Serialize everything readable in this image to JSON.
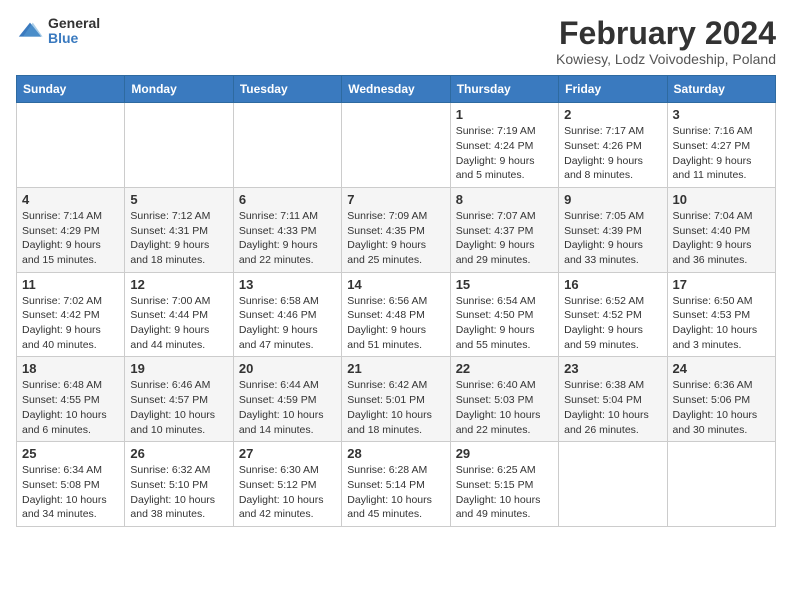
{
  "logo": {
    "line1": "General",
    "line2": "Blue"
  },
  "title": "February 2024",
  "location": "Kowiesy, Lodz Voivodeship, Poland",
  "days_of_week": [
    "Sunday",
    "Monday",
    "Tuesday",
    "Wednesday",
    "Thursday",
    "Friday",
    "Saturday"
  ],
  "weeks": [
    [
      {
        "day": "",
        "info": ""
      },
      {
        "day": "",
        "info": ""
      },
      {
        "day": "",
        "info": ""
      },
      {
        "day": "",
        "info": ""
      },
      {
        "day": "1",
        "info": "Sunrise: 7:19 AM\nSunset: 4:24 PM\nDaylight: 9 hours and 5 minutes."
      },
      {
        "day": "2",
        "info": "Sunrise: 7:17 AM\nSunset: 4:26 PM\nDaylight: 9 hours and 8 minutes."
      },
      {
        "day": "3",
        "info": "Sunrise: 7:16 AM\nSunset: 4:27 PM\nDaylight: 9 hours and 11 minutes."
      }
    ],
    [
      {
        "day": "4",
        "info": "Sunrise: 7:14 AM\nSunset: 4:29 PM\nDaylight: 9 hours and 15 minutes."
      },
      {
        "day": "5",
        "info": "Sunrise: 7:12 AM\nSunset: 4:31 PM\nDaylight: 9 hours and 18 minutes."
      },
      {
        "day": "6",
        "info": "Sunrise: 7:11 AM\nSunset: 4:33 PM\nDaylight: 9 hours and 22 minutes."
      },
      {
        "day": "7",
        "info": "Sunrise: 7:09 AM\nSunset: 4:35 PM\nDaylight: 9 hours and 25 minutes."
      },
      {
        "day": "8",
        "info": "Sunrise: 7:07 AM\nSunset: 4:37 PM\nDaylight: 9 hours and 29 minutes."
      },
      {
        "day": "9",
        "info": "Sunrise: 7:05 AM\nSunset: 4:39 PM\nDaylight: 9 hours and 33 minutes."
      },
      {
        "day": "10",
        "info": "Sunrise: 7:04 AM\nSunset: 4:40 PM\nDaylight: 9 hours and 36 minutes."
      }
    ],
    [
      {
        "day": "11",
        "info": "Sunrise: 7:02 AM\nSunset: 4:42 PM\nDaylight: 9 hours and 40 minutes."
      },
      {
        "day": "12",
        "info": "Sunrise: 7:00 AM\nSunset: 4:44 PM\nDaylight: 9 hours and 44 minutes."
      },
      {
        "day": "13",
        "info": "Sunrise: 6:58 AM\nSunset: 4:46 PM\nDaylight: 9 hours and 47 minutes."
      },
      {
        "day": "14",
        "info": "Sunrise: 6:56 AM\nSunset: 4:48 PM\nDaylight: 9 hours and 51 minutes."
      },
      {
        "day": "15",
        "info": "Sunrise: 6:54 AM\nSunset: 4:50 PM\nDaylight: 9 hours and 55 minutes."
      },
      {
        "day": "16",
        "info": "Sunrise: 6:52 AM\nSunset: 4:52 PM\nDaylight: 9 hours and 59 minutes."
      },
      {
        "day": "17",
        "info": "Sunrise: 6:50 AM\nSunset: 4:53 PM\nDaylight: 10 hours and 3 minutes."
      }
    ],
    [
      {
        "day": "18",
        "info": "Sunrise: 6:48 AM\nSunset: 4:55 PM\nDaylight: 10 hours and 6 minutes."
      },
      {
        "day": "19",
        "info": "Sunrise: 6:46 AM\nSunset: 4:57 PM\nDaylight: 10 hours and 10 minutes."
      },
      {
        "day": "20",
        "info": "Sunrise: 6:44 AM\nSunset: 4:59 PM\nDaylight: 10 hours and 14 minutes."
      },
      {
        "day": "21",
        "info": "Sunrise: 6:42 AM\nSunset: 5:01 PM\nDaylight: 10 hours and 18 minutes."
      },
      {
        "day": "22",
        "info": "Sunrise: 6:40 AM\nSunset: 5:03 PM\nDaylight: 10 hours and 22 minutes."
      },
      {
        "day": "23",
        "info": "Sunrise: 6:38 AM\nSunset: 5:04 PM\nDaylight: 10 hours and 26 minutes."
      },
      {
        "day": "24",
        "info": "Sunrise: 6:36 AM\nSunset: 5:06 PM\nDaylight: 10 hours and 30 minutes."
      }
    ],
    [
      {
        "day": "25",
        "info": "Sunrise: 6:34 AM\nSunset: 5:08 PM\nDaylight: 10 hours and 34 minutes."
      },
      {
        "day": "26",
        "info": "Sunrise: 6:32 AM\nSunset: 5:10 PM\nDaylight: 10 hours and 38 minutes."
      },
      {
        "day": "27",
        "info": "Sunrise: 6:30 AM\nSunset: 5:12 PM\nDaylight: 10 hours and 42 minutes."
      },
      {
        "day": "28",
        "info": "Sunrise: 6:28 AM\nSunset: 5:14 PM\nDaylight: 10 hours and 45 minutes."
      },
      {
        "day": "29",
        "info": "Sunrise: 6:25 AM\nSunset: 5:15 PM\nDaylight: 10 hours and 49 minutes."
      },
      {
        "day": "",
        "info": ""
      },
      {
        "day": "",
        "info": ""
      }
    ]
  ]
}
